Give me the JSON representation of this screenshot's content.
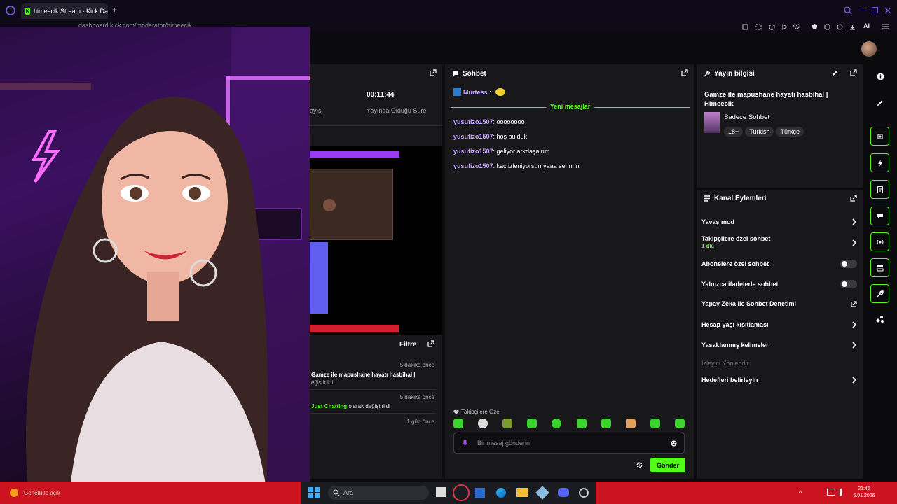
{
  "browser": {
    "tab_title": "himeecik Stream - Kick Da",
    "address": "dashboard.kick.com/moderator/himeecik",
    "ai_label": "AI"
  },
  "left_panel": {
    "timer": "00:11:44",
    "timer_label": "Yayında Olduğu Süre",
    "viewers_label": "ayısı",
    "activity_title": "Filtre",
    "activity": [
      {
        "time": "5 dakika önce",
        "text": "Gamze ile mapushane hayatı hasbihal |",
        "sub": "eğiştirildi"
      },
      {
        "time": "5 dakika önce",
        "highlight": "Just Chatting",
        "text": " olarak değiştirildi"
      },
      {
        "time": "1 gün önce"
      }
    ]
  },
  "chat": {
    "title": "Sohbet",
    "pinned_user": "Murtess",
    "new_messages": "Yeni mesajlar",
    "messages": [
      {
        "user": "yusufizo1507",
        "text": ": oooooooo"
      },
      {
        "user": "yusufizo1507",
        "text": ": hoş bulduk"
      },
      {
        "user": "yusufizo1507",
        "text": ": geliyor arkdaşalrım"
      },
      {
        "user": "yusufizo1507",
        "text": ": kaç izleniyorsun yaaa sennnn"
      }
    ],
    "followers_only": "Takipçilere Özel",
    "placeholder": "Bir mesaj gönderin",
    "send": "Gönder"
  },
  "stream_info": {
    "title": "Yayın bilgisi",
    "stream_title": "Gamze ile mapushane hayatı hasbihal | Himeecik",
    "category": "Sadece Sohbet",
    "tags": [
      "18+",
      "Turkish",
      "Türkçe"
    ]
  },
  "channel_actions": {
    "title": "Kanal Eylemleri",
    "slow_mode": "Yavaş mod",
    "followers_chat": "Takipçilere özel sohbet",
    "followers_duration": "1 dk.",
    "subs_chat": "Abonelere özel sohbet",
    "emote_chat": "Yalnızca ifadelerle sohbet",
    "ai_mod": "Yapay Zeka ile Sohbet Denetimi",
    "age_limit": "Hesap yaşı kısıtlaması",
    "banned_words": "Yasaklanmış kelimeler",
    "redirect": "İzleyici Yönlendir",
    "goals": "Hedefleri belirleyin"
  },
  "taskbar": {
    "search": "Ara",
    "left_status": "Genellikle açık",
    "time": "21:46",
    "date": "5.01.2026"
  },
  "colors": {
    "accent": "#53fc18",
    "username": "#c7a6ff",
    "taskbar": "#cc1420"
  }
}
